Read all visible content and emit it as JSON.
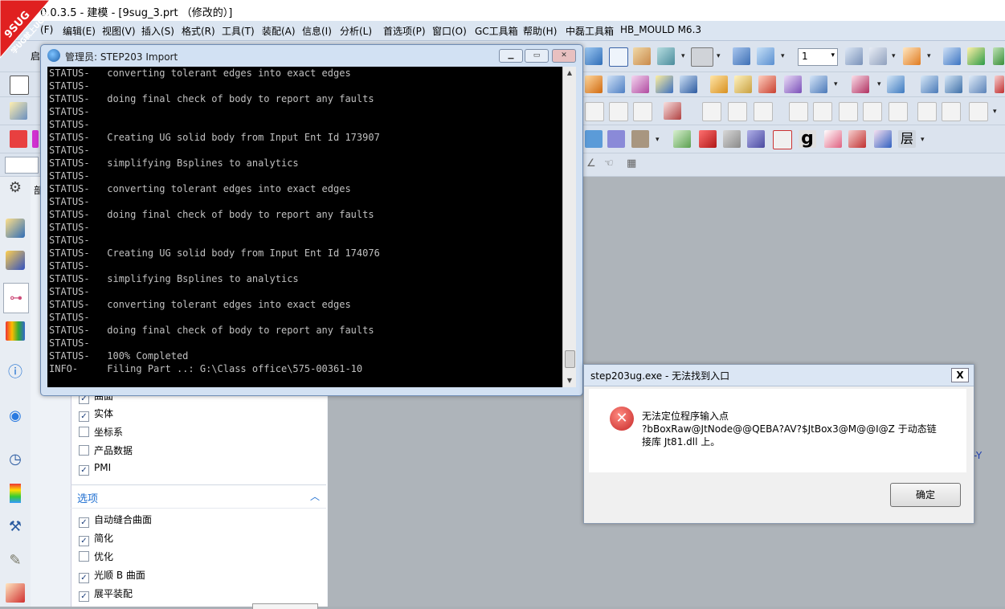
{
  "title": "0.0.3.5 - 建模 - [9sug_3.prt （修改的）]",
  "watermark": {
    "line1": "9SUG",
    "line2": "学UG就上UG网"
  },
  "menu": [
    "(F)",
    "编辑(E)",
    "视图(V)",
    "插入(S)",
    "格式(R)",
    "工具(T)",
    "装配(A)",
    "信息(I)",
    "分析(L)",
    "首选项(P)",
    "窗口(O)",
    "GC工具箱",
    "帮助(H)",
    "中磊工具箱",
    "HB_MOULD M6.3"
  ],
  "toolbar": {
    "start_label": "启",
    "layer_value": "1",
    "layer_label": "层"
  },
  "panel": {
    "tab_label": "部",
    "checkboxes_top": [
      {
        "label": "曲面",
        "checked": true
      },
      {
        "label": "实体",
        "checked": true
      },
      {
        "label": "坐标系",
        "checked": false
      },
      {
        "label": "产品数据",
        "checked": false
      },
      {
        "label": "PMI",
        "checked": true
      }
    ],
    "options_title": "选项",
    "options": [
      {
        "label": "自动缝合曲面",
        "checked": true
      },
      {
        "label": "简化",
        "checked": true
      },
      {
        "label": "优化",
        "checked": false
      },
      {
        "label": "光顺 B 曲面",
        "checked": true
      },
      {
        "label": "展平装配",
        "checked": true
      }
    ]
  },
  "console": {
    "title": "管理员:  STEP203 Import",
    "lines": [
      "STATUS-   converting tolerant edges into exact edges",
      "STATUS-",
      "STATUS-   doing final check of body to report any faults",
      "STATUS-",
      "STATUS-",
      "STATUS-   Creating UG solid body from Input Ent Id 173907",
      "STATUS-",
      "STATUS-   simplifying Bsplines to analytics",
      "STATUS-",
      "STATUS-   converting tolerant edges into exact edges",
      "STATUS-",
      "STATUS-   doing final check of body to report any faults",
      "STATUS-",
      "STATUS-",
      "STATUS-   Creating UG solid body from Input Ent Id 174076",
      "STATUS-",
      "STATUS-   simplifying Bsplines to analytics",
      "STATUS-",
      "STATUS-   converting tolerant edges into exact edges",
      "STATUS-",
      "STATUS-   doing final check of body to report any faults",
      "STATUS-",
      "STATUS-   100% Completed",
      "INFO-     Filing Part ..: G:\\Class office\\575-00361-10"
    ]
  },
  "error_dialog": {
    "title": "step203ug.exe - 无法找到入口",
    "line1": "无法定位程序输入点",
    "line2": "?bBoxRaw@JtNode@@QEBA?AV?$JtBox3@M@@I@Z 于动态链",
    "line3": "接库 Jt81.dll 上。",
    "ok_label": "确定",
    "close_label": "X"
  },
  "axis_label": "-Y",
  "colors": {
    "accent": "#1f6fd1",
    "console_bg": "#000000",
    "console_text": "#c0c0c0",
    "badge_red": "#e02020"
  }
}
